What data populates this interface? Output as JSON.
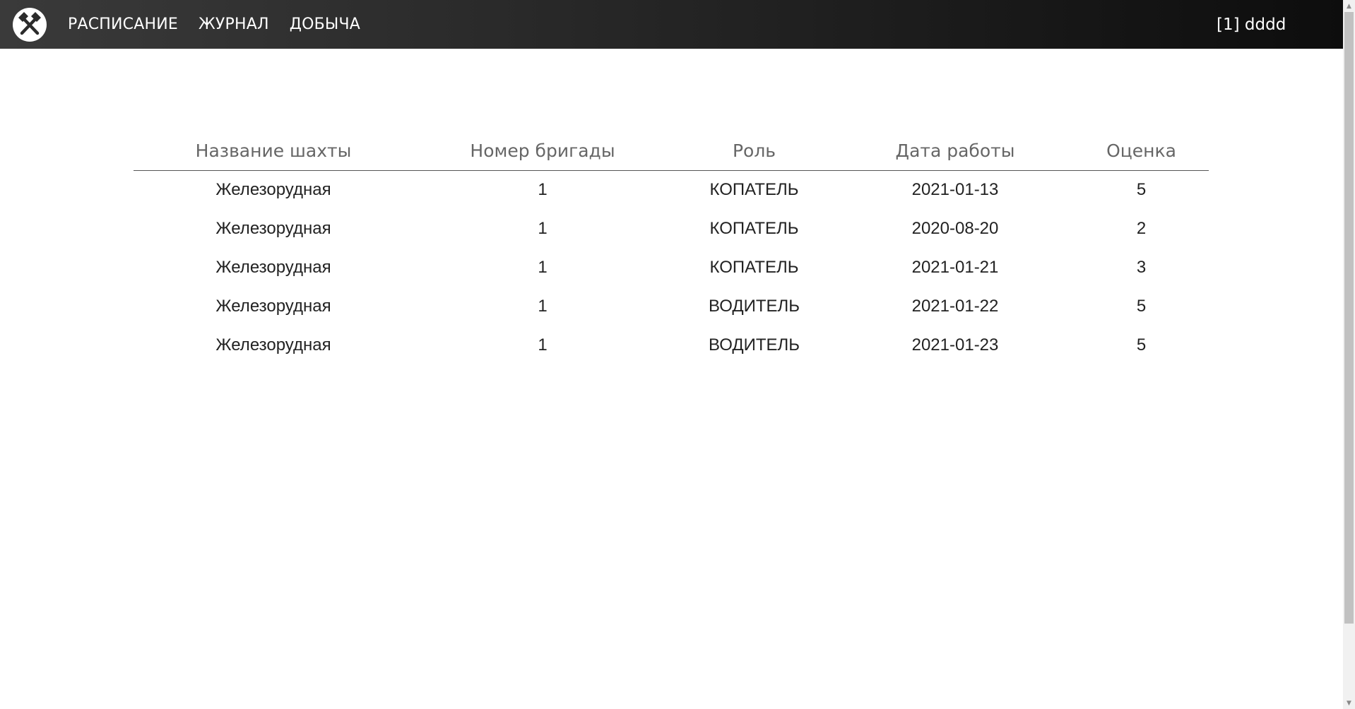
{
  "nav": {
    "logo_icon": "crossed-hammers-icon",
    "links": [
      "РАСПИСАНИЕ",
      "ЖУРНАЛ",
      "ДОБЫЧА"
    ],
    "user": "[1] dddd"
  },
  "table": {
    "headers": [
      "Название шахты",
      "Номер бригады",
      "Роль",
      "Дата работы",
      "Оценка"
    ],
    "rows": [
      [
        "Железорудная",
        "1",
        "КОПАТЕЛЬ",
        "2021-01-13",
        "5"
      ],
      [
        "Железорудная",
        "1",
        "КОПАТЕЛЬ",
        "2020-08-20",
        "2"
      ],
      [
        "Железорудная",
        "1",
        "КОПАТЕЛЬ",
        "2021-01-21",
        "3"
      ],
      [
        "Железорудная",
        "1",
        "ВОДИТЕЛЬ",
        "2021-01-22",
        "5"
      ],
      [
        "Железорудная",
        "1",
        "ВОДИТЕЛЬ",
        "2021-01-23",
        "5"
      ]
    ]
  },
  "colors": {
    "navbar": "#2a2a2a",
    "header_text": "#666666",
    "cell_text": "#222222"
  }
}
